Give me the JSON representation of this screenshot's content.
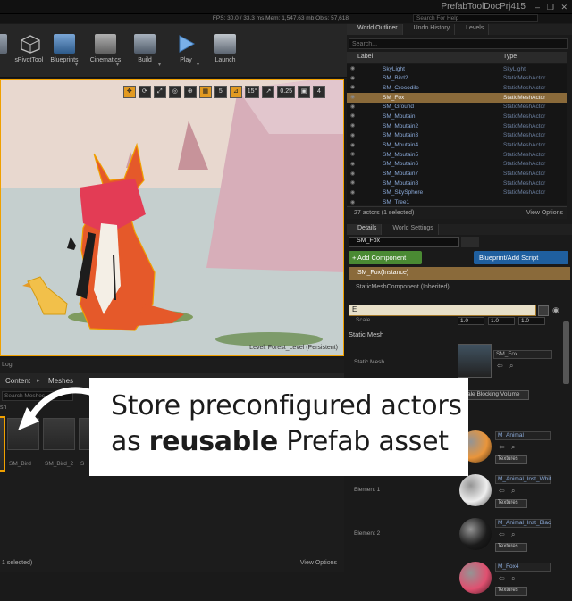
{
  "window": {
    "project_title": "PrefabToolDocPrj415",
    "stats": "FPS: 30.0 / 33.3 ms   Mem: 1,547.63 mb   Objs: 57,618",
    "help_placeholder": "Search For Help",
    "controls": [
      "–",
      "❐",
      "✕"
    ]
  },
  "toolbar": {
    "items": [
      {
        "label": "s",
        "icon": "settings-icon"
      },
      {
        "label": "PivotTool",
        "icon": "cube-icon"
      },
      {
        "label": "Blueprints",
        "icon": "blueprint-icon"
      },
      {
        "label": "Cinematics",
        "icon": "clapper-icon"
      },
      {
        "label": "Build",
        "icon": "build-icon"
      },
      {
        "label": "Play",
        "icon": "play-icon"
      },
      {
        "label": "Launch",
        "icon": "launch-icon"
      }
    ]
  },
  "viewport": {
    "tools": [
      "✥",
      "⟳",
      "⤢",
      "◎",
      "⊕",
      "▦",
      "5",
      "⊿",
      "15°",
      "↗",
      "0.25",
      "▣",
      "4"
    ],
    "level_label": "Level:  Forest_Level (Persistent)"
  },
  "outliner": {
    "tabs": [
      "World Outliner",
      "Undo History",
      "Levels"
    ],
    "search_placeholder": "Search...",
    "col_label": "Label",
    "col_type": "Type",
    "rows": [
      {
        "name": "SkyLight",
        "type": "SkyLight",
        "selected": false
      },
      {
        "name": "SM_Bird2",
        "type": "StaticMeshActor",
        "selected": false
      },
      {
        "name": "SM_Crocodile",
        "type": "StaticMeshActor",
        "selected": false
      },
      {
        "name": "SM_Fox",
        "type": "StaticMeshActor",
        "selected": true
      },
      {
        "name": "SM_Ground",
        "type": "StaticMeshActor",
        "selected": false
      },
      {
        "name": "SM_Moutain",
        "type": "StaticMeshActor",
        "selected": false
      },
      {
        "name": "SM_Moutain2",
        "type": "StaticMeshActor",
        "selected": false
      },
      {
        "name": "SM_Moutain3",
        "type": "StaticMeshActor",
        "selected": false
      },
      {
        "name": "SM_Moutain4",
        "type": "StaticMeshActor",
        "selected": false
      },
      {
        "name": "SM_Moutain5",
        "type": "StaticMeshActor",
        "selected": false
      },
      {
        "name": "SM_Moutain6",
        "type": "StaticMeshActor",
        "selected": false
      },
      {
        "name": "SM_Moutain7",
        "type": "StaticMeshActor",
        "selected": false
      },
      {
        "name": "SM_Moutain8",
        "type": "StaticMeshActor",
        "selected": false
      },
      {
        "name": "SM_SkySphere",
        "type": "StaticMeshActor",
        "selected": false
      },
      {
        "name": "SM_Tree1",
        "type": "",
        "selected": false
      }
    ],
    "actor_count": "27 actors (1 selected)",
    "view_options": "View Options"
  },
  "details": {
    "tabs": [
      "Details",
      "World Settings"
    ],
    "actor_name": "SM_Fox",
    "add_component": "+ Add Component",
    "blueprint_script": "Blueprint/Add Script",
    "instance": "SM_Fox(Instance)",
    "static_component": "StaticMeshComponent (Inherited)",
    "search_value": "E",
    "scale_label": "Scale",
    "scale_values": [
      "1.0",
      "1.0",
      "1.0"
    ],
    "section_static_mesh": "Static Mesh",
    "static_mesh_label": "Static Mesh",
    "static_mesh_value": "SM_Fox",
    "collision_value": "ale Blocking Volume",
    "elements": [
      {
        "label": "",
        "material": "M_Animal",
        "color": "#e9953b"
      },
      {
        "label": "Element 1",
        "material": "M_Animal_Inst_Whit",
        "color": "#eeeeee"
      },
      {
        "label": "Element 2",
        "material": "M_Animal_Inst_Blac",
        "color": "#1b1b1b"
      },
      {
        "label": "",
        "material": "M_Fox4",
        "color": "#e05070"
      }
    ],
    "textures_label": "Textures"
  },
  "content": {
    "log_tab": "Log",
    "path_1": "Content",
    "path_2": "Meshes",
    "search_placeholder": "Search Meshes",
    "side_label": "sh",
    "assets": [
      {
        "label": "SM_Bird",
        "selected": false
      },
      {
        "label": "SM_Bird_2",
        "selected": false
      },
      {
        "label": "S",
        "selected": false
      }
    ],
    "selected_text": "1 selected)",
    "view_options": "View Options"
  },
  "callout": {
    "line1": "Store preconfigured actors",
    "line2_pre": "as ",
    "line2_bold": "reusable",
    "line2_post": " Prefab asset"
  },
  "colors": {
    "accent": "#f0a000",
    "selection": "#8a6a3a",
    "add_component_green": "#4a8a33",
    "blueprint_blue": "#1f5f9f"
  }
}
